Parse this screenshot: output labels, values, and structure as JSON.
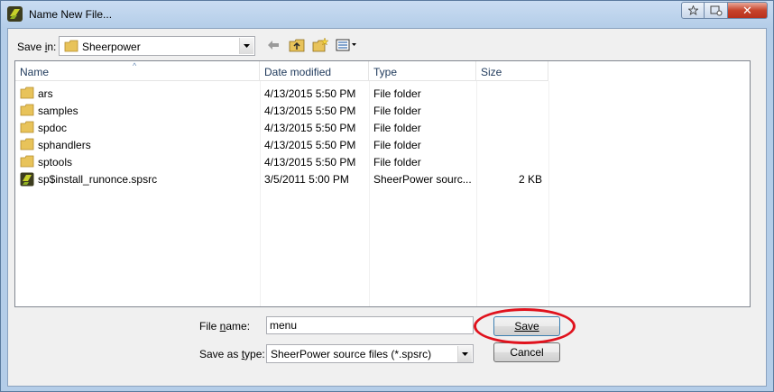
{
  "window": {
    "title": "Name New File...",
    "buttons": {
      "close": "✕"
    }
  },
  "savein": {
    "label": "Save in:",
    "value": "Sheerpower"
  },
  "columns": [
    "Name",
    "Date modified",
    "Type",
    "Size"
  ],
  "files": [
    {
      "name": "ars",
      "date": "4/13/2015 5:50 PM",
      "type": "File folder",
      "size": "",
      "icon": "folder-icon"
    },
    {
      "name": "samples",
      "date": "4/13/2015 5:50 PM",
      "type": "File folder",
      "size": "",
      "icon": "folder-icon"
    },
    {
      "name": "spdoc",
      "date": "4/13/2015 5:50 PM",
      "type": "File folder",
      "size": "",
      "icon": "folder-icon"
    },
    {
      "name": "sphandlers",
      "date": "4/13/2015 5:50 PM",
      "type": "File folder",
      "size": "",
      "icon": "folder-icon"
    },
    {
      "name": "sptools",
      "date": "4/13/2015 5:50 PM",
      "type": "File folder",
      "size": "",
      "icon": "folder-icon"
    },
    {
      "name": "sp$install_runonce.spsrc",
      "date": "3/5/2011 5:00 PM",
      "type": "SheerPower sourc...",
      "size": "2 KB",
      "icon": "sheerpower-file-icon"
    }
  ],
  "filename": {
    "label": "File name:",
    "value": "menu"
  },
  "savetype": {
    "label": "Save as type:",
    "value": "SheerPower source files (*.spsrc)"
  },
  "buttons": {
    "save": "Save",
    "cancel": "Cancel"
  },
  "colors": {
    "highlight": "#e0121d",
    "folder": "#e8c35a"
  }
}
